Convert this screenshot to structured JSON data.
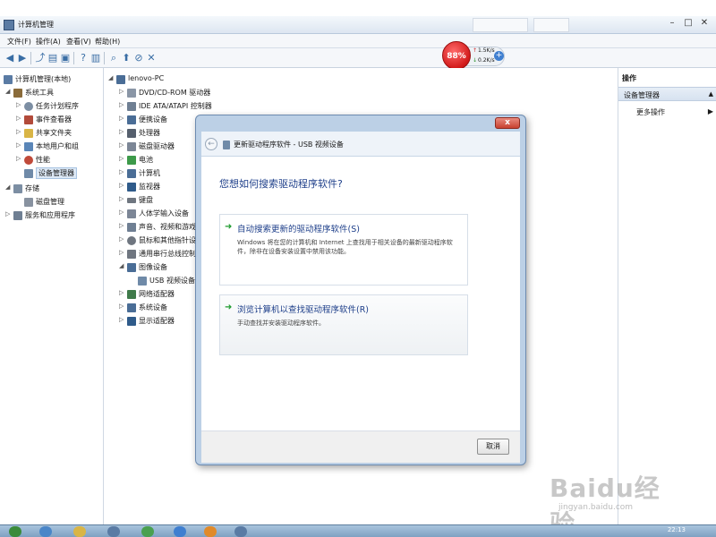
{
  "window": {
    "title": "计算机管理",
    "ghost_tabs": [
      "",
      ""
    ],
    "controls": {
      "minimize": "–",
      "maximize": "□",
      "close": "✕"
    }
  },
  "menubar": {
    "items": [
      "文件(F)",
      "操作(A)",
      "查看(V)",
      "帮助(H)"
    ]
  },
  "toolbar": {
    "icons": [
      "back-icon",
      "forward-icon",
      "up-icon",
      "show-hide-tree-icon",
      "refresh-icon",
      "help-icon",
      "properties-icon",
      "scan-hardware-icon",
      "update-driver-icon",
      "disable-icon",
      "uninstall-icon"
    ]
  },
  "netmonitor": {
    "percent": "88%",
    "upload": "1.5K/s",
    "download": "0.2K/s",
    "up_arrow": "↑",
    "down_arrow": "↓",
    "add": "+"
  },
  "left_tree": {
    "items": [
      {
        "label": "计算机管理(本地)",
        "expander": "",
        "icon_color": "#5a7ba4",
        "indent": 0
      },
      {
        "label": "系统工具",
        "expander": "◢",
        "icon_color": "#8a6b3a",
        "indent": 1
      },
      {
        "label": "任务计划程序",
        "expander": "▷",
        "icon_color": "#7c8ea3",
        "indent": 2
      },
      {
        "label": "事件查看器",
        "expander": "▷",
        "icon_color": "#b24a3a",
        "indent": 2
      },
      {
        "label": "共享文件夹",
        "expander": "▷",
        "icon_color": "#d9b546",
        "indent": 2
      },
      {
        "label": "本地用户和组",
        "expander": "▷",
        "icon_color": "#5a86b8",
        "indent": 2
      },
      {
        "label": "性能",
        "expander": "▷",
        "icon_color": "#c04a3a",
        "indent": 2
      },
      {
        "label": "设备管理器",
        "expander": "",
        "icon_color": "#6f8aa8",
        "indent": 2,
        "selected": true
      },
      {
        "label": "存储",
        "expander": "◢",
        "icon_color": "#7c8ea3",
        "indent": 1
      },
      {
        "label": "磁盘管理",
        "expander": "",
        "icon_color": "#8892a0",
        "indent": 2
      },
      {
        "label": "服务和应用程序",
        "expander": "▷",
        "icon_color": "#6f7f93",
        "indent": 1
      }
    ]
  },
  "device_tree": {
    "items": [
      {
        "label": "lenovo-PC",
        "expander": "◢",
        "icon_color": "#4a6d96",
        "indent": 0
      },
      {
        "label": "DVD/CD-ROM 驱动器",
        "expander": "▷",
        "icon_color": "#8a96a6",
        "indent": 1
      },
      {
        "label": "IDE ATA/ATAPI 控制器",
        "expander": "▷",
        "icon_color": "#6f7f93",
        "indent": 1
      },
      {
        "label": "便携设备",
        "expander": "▷",
        "icon_color": "#4a6d96",
        "indent": 1
      },
      {
        "label": "处理器",
        "expander": "▷",
        "icon_color": "#555f6d",
        "indent": 1
      },
      {
        "label": "磁盘驱动器",
        "expander": "▷",
        "icon_color": "#7c8696",
        "indent": 1
      },
      {
        "label": "电池",
        "expander": "▷",
        "icon_color": "#3d9a4a",
        "indent": 1
      },
      {
        "label": "计算机",
        "expander": "▷",
        "icon_color": "#4a6d96",
        "indent": 1
      },
      {
        "label": "监视器",
        "expander": "▷",
        "icon_color": "#2f5b8a",
        "indent": 1
      },
      {
        "label": "键盘",
        "expander": "▷",
        "icon_color": "#6f7680",
        "indent": 1
      },
      {
        "label": "人体学输入设备",
        "expander": "▷",
        "icon_color": "#7c8696",
        "indent": 1
      },
      {
        "label": "声音、视频和游戏控制器",
        "expander": "▷",
        "icon_color": "#6f7f93",
        "indent": 1
      },
      {
        "label": "鼠标和其他指针设备",
        "expander": "▷",
        "icon_color": "#6f7680",
        "indent": 1
      },
      {
        "label": "通用串行总线控制器",
        "expander": "▷",
        "icon_color": "#6f7680",
        "indent": 1
      },
      {
        "label": "图像设备",
        "expander": "◢",
        "icon_color": "#4a6d96",
        "indent": 1
      },
      {
        "label": "USB 视频设备",
        "expander": "",
        "icon_color": "#6f8aa8",
        "indent": 2
      },
      {
        "label": "网络适配器",
        "expander": "▷",
        "icon_color": "#3f7a4a",
        "indent": 1
      },
      {
        "label": "系统设备",
        "expander": "▷",
        "icon_color": "#4a6d96",
        "indent": 1
      },
      {
        "label": "显示适配器",
        "expander": "▷",
        "icon_color": "#2f5b8a",
        "indent": 1
      }
    ]
  },
  "actions": {
    "title": "操作",
    "section": "设备管理器",
    "section_arrow": "▲",
    "more": "更多操作",
    "more_arrow": "▶"
  },
  "dialog": {
    "close": "x",
    "back": "←",
    "title": "更新驱动程序软件 - USB 视频设备",
    "question": "您想如何搜索驱动程序软件?",
    "options": [
      {
        "arrow": "➜",
        "title": "自动搜索更新的驱动程序软件(S)",
        "desc": "Windows 将在您的计算机和 Internet 上查找用于相关设备的最新驱动程序软件，除非在设备安装设置中禁用该功能。"
      },
      {
        "arrow": "➜",
        "title": "浏览计算机以查找驱动程序软件(R)",
        "desc": "手动查找并安装驱动程序软件。"
      }
    ],
    "cancel": "取消"
  },
  "watermark": {
    "logo": "Baidu经验",
    "url": "jingyan.baidu.com"
  },
  "taskbar": {
    "clock": "22:13",
    "buttons": [
      "start-orb-icon",
      "ie-icon",
      "explorer-icon",
      "media-icon",
      "chrome-icon",
      "app-icon",
      "app-icon",
      "app-icon"
    ]
  }
}
